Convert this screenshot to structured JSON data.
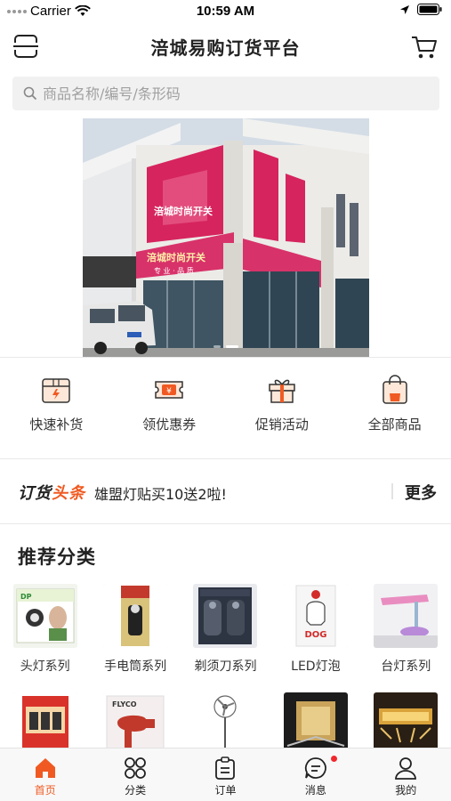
{
  "status_bar": {
    "carrier": "Carrier",
    "time": "10:59 AM"
  },
  "nav": {
    "title": "涪城易购订货平台",
    "scan_icon": "scan-icon",
    "cart_icon": "cart-icon"
  },
  "search": {
    "placeholder": "商品名称/编号/条形码",
    "icon": "search-icon"
  },
  "banner": {
    "sign_top": "涪城时尚开关",
    "sign_mid": "涪城时尚开关",
    "sign_sub": "专 业 · 品 质",
    "page_count": 2,
    "active_page": 1
  },
  "quick_actions": [
    {
      "label": "快速补货",
      "icon": "box-icon"
    },
    {
      "label": "领优惠券",
      "icon": "coupon-icon"
    },
    {
      "label": "促销活动",
      "icon": "gift-icon"
    },
    {
      "label": "全部商品",
      "icon": "bag-icon"
    }
  ],
  "headline": {
    "brand_part1": "订货",
    "brand_part2": "头条",
    "text": "雄盟灯贴买10送2啦!",
    "more": "更多"
  },
  "recommended": {
    "title": "推荐分类",
    "row1": [
      {
        "label": "头灯系列",
        "image": "headlamp-product"
      },
      {
        "label": "手电筒系列",
        "image": "flashlight-product"
      },
      {
        "label": "剃须刀系列",
        "image": "shaver-product"
      },
      {
        "label": "LED灯泡",
        "image": "led-bulb-product"
      },
      {
        "label": "台灯系列",
        "image": "desk-lamp-product"
      }
    ],
    "row2": [
      {
        "image": "battery-product"
      },
      {
        "image": "hair-dryer-product"
      },
      {
        "image": "fan-product"
      },
      {
        "image": "switch-panel-product"
      },
      {
        "image": "ceiling-light-product"
      }
    ]
  },
  "tabs": [
    {
      "label": "首页",
      "icon": "home-icon",
      "active": true
    },
    {
      "label": "分类",
      "icon": "category-icon",
      "active": false
    },
    {
      "label": "订单",
      "icon": "order-icon",
      "active": false
    },
    {
      "label": "消息",
      "icon": "message-icon",
      "active": false,
      "badge": true
    },
    {
      "label": "我的",
      "icon": "profile-icon",
      "active": false
    }
  ],
  "colors": {
    "accent": "#f05a22",
    "badge": "#f0282d"
  }
}
